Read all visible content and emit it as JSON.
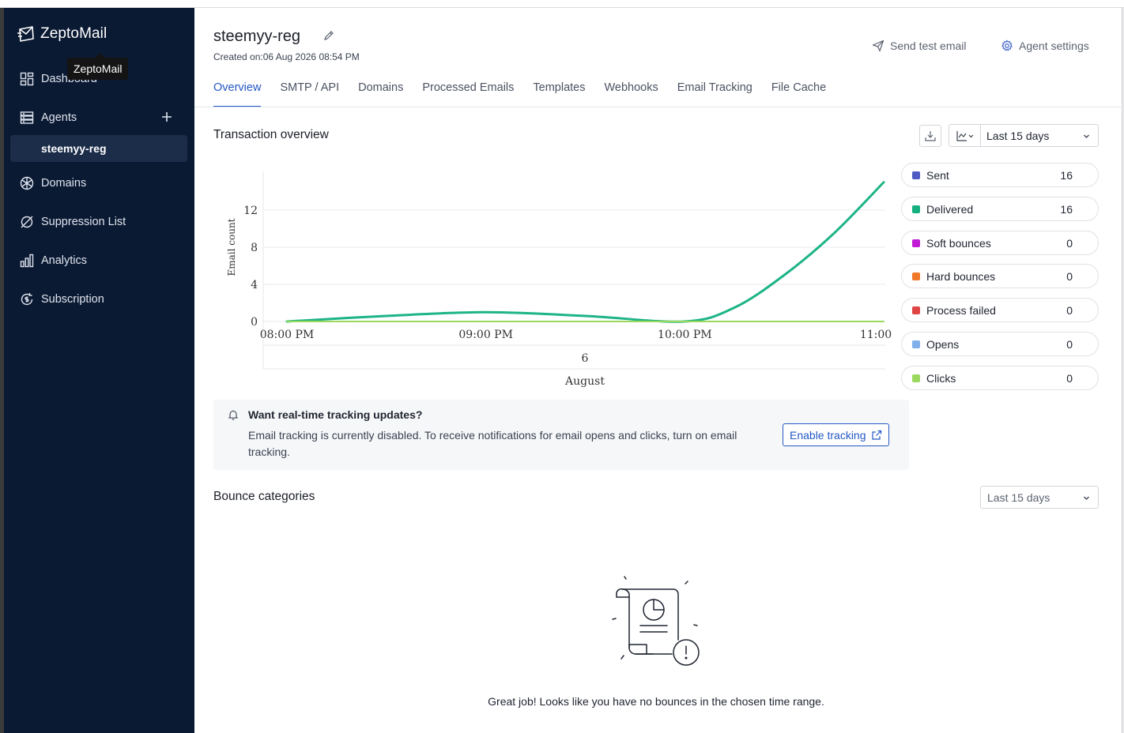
{
  "app": {
    "brand": "ZeptoMail",
    "tooltip": "ZeptoMail"
  },
  "sidebar": {
    "items": [
      {
        "label": "Dashboard"
      },
      {
        "label": "Agents"
      },
      {
        "label": "Domains"
      },
      {
        "label": "Suppression List"
      },
      {
        "label": "Analytics"
      },
      {
        "label": "Subscription"
      }
    ],
    "active_agent": "steemyy-reg"
  },
  "header": {
    "title": "steemyy-reg",
    "created": "Created on:06 Aug 2026 08:54 PM",
    "send_test": "Send test email",
    "agent_settings": "Agent settings"
  },
  "tabs": [
    "Overview",
    "SMTP / API",
    "Domains",
    "Processed Emails",
    "Templates",
    "Webhooks",
    "Email Tracking",
    "File Cache"
  ],
  "overview": {
    "title": "Transaction overview",
    "range": "Last 15 days"
  },
  "legend": [
    {
      "label": "Sent",
      "count": "16",
      "color": "#4f5bc4"
    },
    {
      "label": "Delivered",
      "count": "16",
      "color": "#14b07f"
    },
    {
      "label": "Soft bounces",
      "count": "0",
      "color": "#c21bd6"
    },
    {
      "label": "Hard bounces",
      "count": "0",
      "color": "#f07a2a"
    },
    {
      "label": "Process failed",
      "count": "0",
      "color": "#e04545"
    },
    {
      "label": "Opens",
      "count": "0",
      "color": "#7fb0ea"
    },
    {
      "label": "Clicks",
      "count": "0",
      "color": "#9bd85e"
    }
  ],
  "chart_data": {
    "type": "line",
    "ylabel": "Email count",
    "x_ticks": [
      "08:00 PM",
      "09:00 PM",
      "10:00 PM",
      "11:00"
    ],
    "x_group": "6",
    "x_group_label": "August",
    "yticks": [
      0,
      4,
      8,
      12
    ],
    "ylim": [
      0,
      16
    ],
    "grid": true,
    "series": [
      {
        "name": "Delivered",
        "color": "#1db487",
        "x": [
          0,
          0.5,
          1,
          1.5,
          2,
          2.25,
          2.5,
          2.75,
          3
        ],
        "values": [
          0,
          0.6,
          1,
          0.6,
          0,
          1.5,
          5,
          9.5,
          15
        ]
      },
      {
        "name": "Clicks",
        "color": "#9bd85e",
        "x": [
          0,
          1,
          2,
          3
        ],
        "values": [
          0,
          0,
          0,
          0
        ]
      }
    ]
  },
  "banner": {
    "title": "Want real-time tracking updates?",
    "text": "Email tracking is currently disabled. To receive notifications for email opens and clicks, turn on email tracking.",
    "button": "Enable tracking"
  },
  "bounce": {
    "title": "Bounce categories",
    "range": "Last 15 days",
    "empty": "Great job! Looks like you have no bounces in the chosen time range."
  }
}
